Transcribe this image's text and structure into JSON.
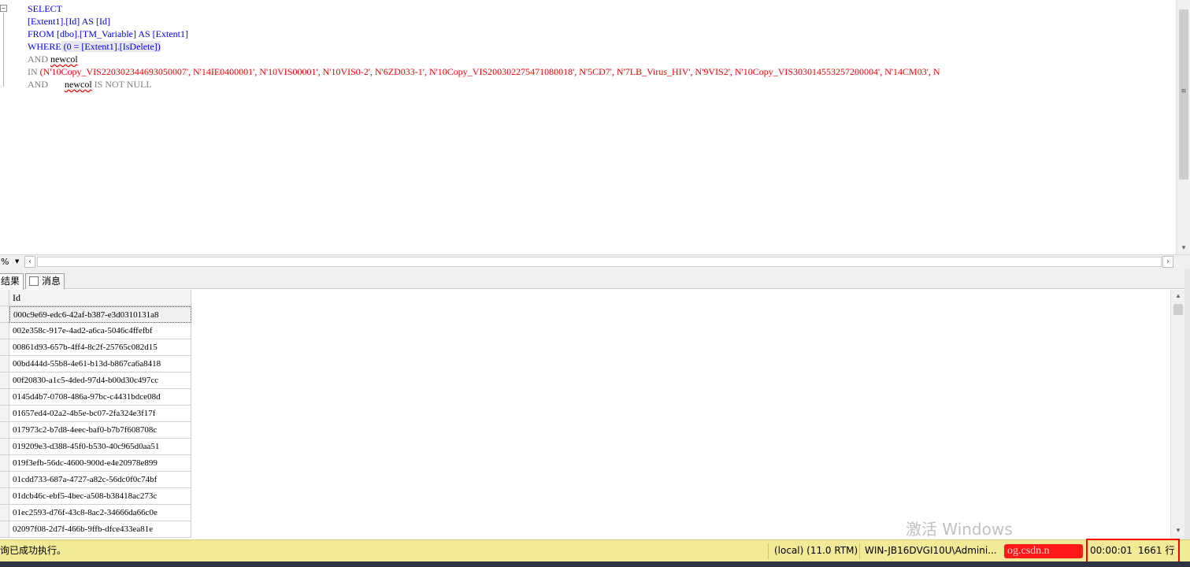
{
  "editor": {
    "top_cut_line": "SELECT ... [Extent1] ...",
    "lines": [
      {
        "kw": "SELECT"
      },
      {
        "text": "[Extent1].[Id] AS [Id]"
      },
      {
        "kw": "FROM",
        "text": " [dbo].[TM_Variable] AS [Extent1]"
      },
      {
        "kw": "WHERE",
        "text": " (0 = [Extent1].[IsDelete])"
      },
      {
        "kw": "AND",
        "col": "newcol"
      },
      {
        "kw": "IN",
        "str": " (N'10Copy_VIS220302344693050007', N'14IE0400001', N'10VIS00001', N'10VIS0-2', N'6ZD033-1', N'10Copy_VIS200302275471080018', N'5CD7', N'7LB_Virus_HIV', N'9VIS2', N'10Copy_VIS303014553257200004', N'14CM03', N"
      },
      {
        "kw": "AND",
        "col": "newcol",
        "rest": " IS NOT NULL"
      }
    ]
  },
  "zoom": "%",
  "tabs": [
    {
      "label": "结果"
    },
    {
      "label": "消息"
    }
  ],
  "grid": {
    "column": "Id",
    "rows": [
      "000c9e69-edc6-42af-b387-e3d0310131a8",
      "002e358c-917e-4ad2-a6ca-5046c4ffefbf",
      "00861d93-657b-4ff4-8c2f-25765c082d15",
      "00bd444d-55b8-4e61-b13d-b867ca6a8418",
      "00f20830-a1c5-4ded-97d4-b00d30c497cc",
      "0145d4b7-0708-486a-97bc-c4431bdce08d",
      "01657ed4-02a2-4b5e-bc07-2fa324e3f17f",
      "017973c2-b7d8-4eec-baf0-b7b7f608708c",
      "019209e3-d388-45f0-b530-40c965d0aa51",
      "019f3efb-56dc-4600-900d-e4e20978e899",
      "01cdd733-687a-4727-a82c-56dc0f0c74bf",
      "01dcb46c-ebf5-4bec-a508-b38418ac273c",
      "01ec2593-d76f-43c8-8ac2-34666da66c0e",
      "02097f08-2d7f-466b-9ffb-dfce433ea81e"
    ]
  },
  "watermark": "激活 Windows",
  "status": {
    "message": "询已成功执行。",
    "server": "(local) (11.0 RTM)",
    "user": "WIN-JB16DVGI10U\\Admini...",
    "overlay": "og.csdn.n",
    "time": "00:00:01",
    "rows": "1661 行"
  }
}
